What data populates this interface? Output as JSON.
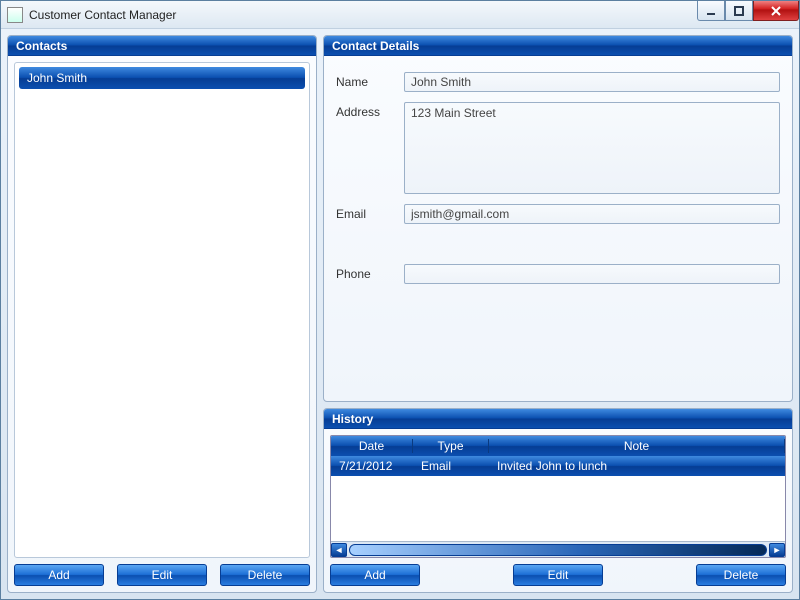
{
  "window": {
    "title": "Customer Contact Manager"
  },
  "contacts": {
    "header": "Contacts",
    "items": [
      {
        "name": "John Smith"
      }
    ],
    "buttons": {
      "add": "Add",
      "edit": "Edit",
      "delete": "Delete"
    }
  },
  "details": {
    "header": "Contact Details",
    "labels": {
      "name": "Name",
      "address": "Address",
      "email": "Email",
      "phone": "Phone"
    },
    "values": {
      "name": "John Smith",
      "address": "123 Main Street",
      "email": "jsmith@gmail.com",
      "phone": ""
    }
  },
  "history": {
    "header": "History",
    "columns": {
      "date": "Date",
      "type": "Type",
      "note": "Note"
    },
    "rows": [
      {
        "date": "7/21/2012",
        "type": "Email",
        "note": "Invited John to lunch"
      }
    ],
    "buttons": {
      "add": "Add",
      "edit": "Edit",
      "delete": "Delete"
    }
  }
}
